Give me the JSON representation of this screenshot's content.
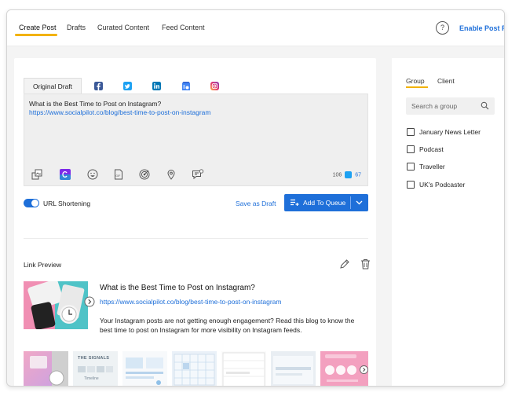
{
  "header": {
    "tabs": [
      {
        "label": "Create Post",
        "active": true
      },
      {
        "label": "Drafts",
        "active": false
      },
      {
        "label": "Curated Content",
        "active": false
      },
      {
        "label": "Feed Content",
        "active": false
      }
    ],
    "help_glyph": "?",
    "enable_link": "Enable Post P"
  },
  "composer": {
    "original_tab": "Original Draft",
    "networks": [
      "facebook-icon",
      "twitter-icon",
      "linkedin-icon",
      "google-business-icon",
      "instagram-icon"
    ],
    "text": "What is the Best Time to Post on Instagram?",
    "link": "https://www.socialpilot.co/blog/best-time-to-post-on-instagram",
    "tools": [
      "media-icon",
      "canva-icon",
      "emoji-icon",
      "gif-icon",
      "target-icon",
      "location-icon",
      "comment-icon"
    ],
    "char_count": "106",
    "twitter_count": "67"
  },
  "actions": {
    "url_shortening_label": "URL Shortening",
    "url_shortening_on": true,
    "save_draft": "Save as Draft",
    "add_to_queue": "Add To Queue"
  },
  "link_preview": {
    "title": "Link Preview",
    "headline": "What is the Best Time to Post on Instagram?",
    "url": "https://www.socialpilot.co/blog/best-time-to-post-on-instagram",
    "description": "Your Instagram posts are not getting enough engagement? Read this blog to know the best time to post on Instagram for more visibility on Instagram feeds.",
    "strip_labels": [
      "THE SIGNALS",
      "Timeline"
    ]
  },
  "sidebar": {
    "tabs": [
      {
        "label": "Group",
        "active": true
      },
      {
        "label": "Client",
        "active": false
      }
    ],
    "search_placeholder": "Search a group",
    "groups": [
      "January News Letter",
      "Podcast",
      "Traveller",
      "UK's Podcaster"
    ]
  },
  "colors": {
    "accent": "#1e6fd9",
    "tab_underline": "#f2b200"
  }
}
